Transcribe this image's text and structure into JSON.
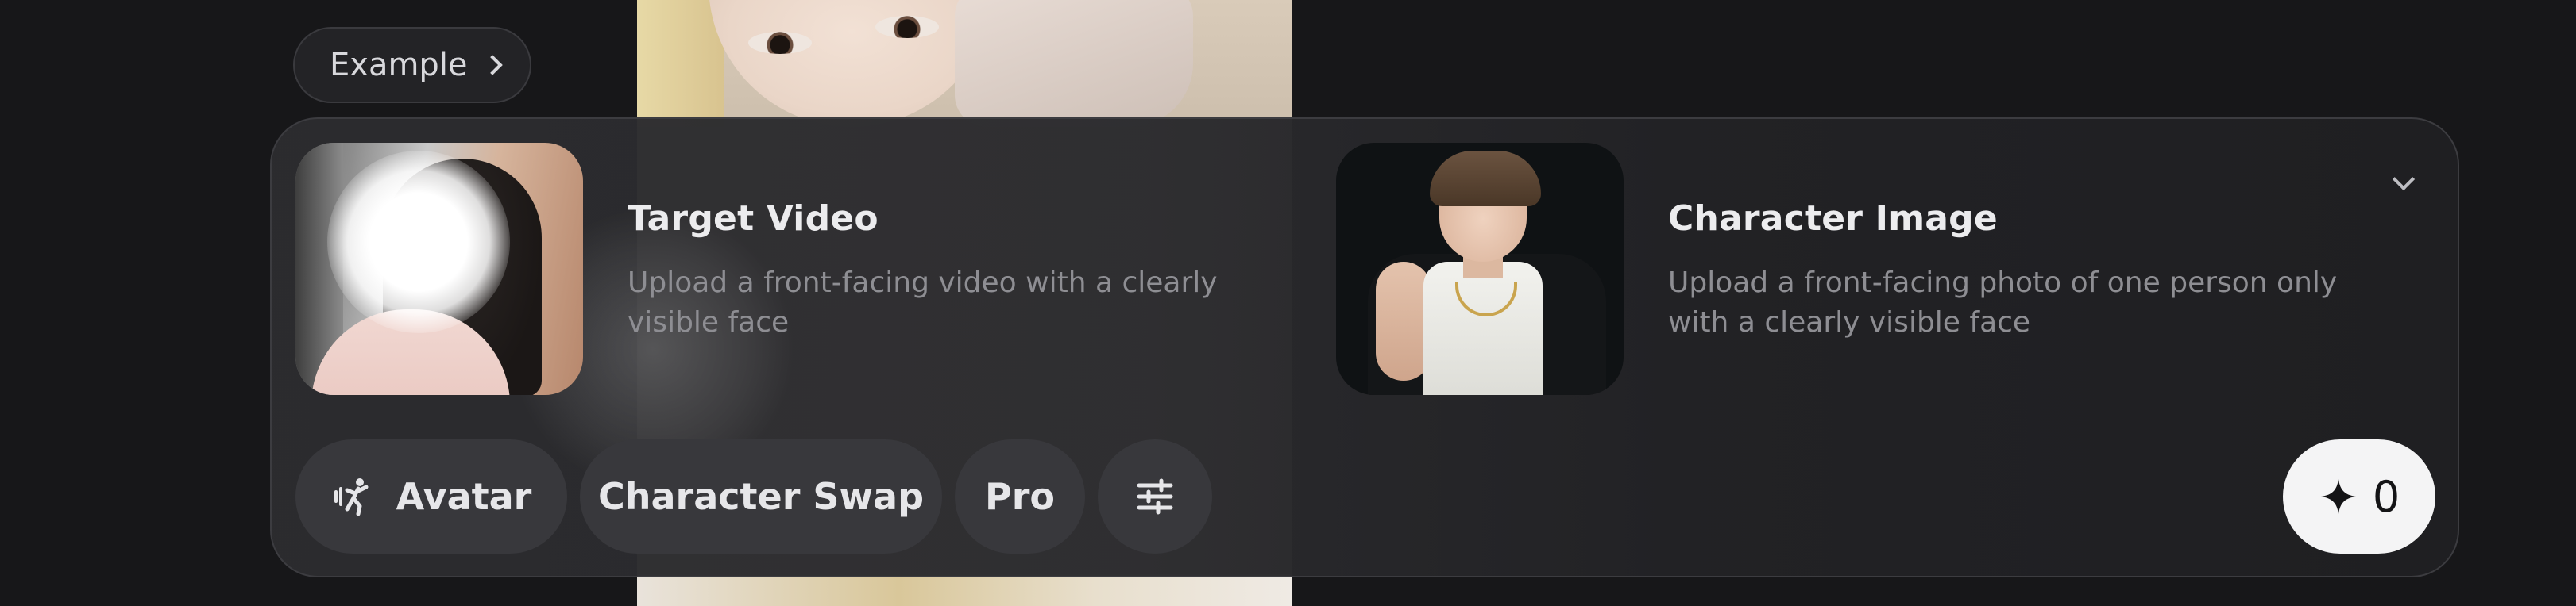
{
  "example_chip": {
    "label": "Example",
    "chevron_icon": "chevron-right-icon"
  },
  "card": {
    "target_video": {
      "title": "Target Video",
      "description": "Upload a front-facing video with a clearly visible face"
    },
    "character_image": {
      "title": "Character Image",
      "description": "Upload a front-facing photo of one person only with a clearly visible face"
    },
    "collapse_icon": "chevron-down-icon"
  },
  "toolbar": {
    "avatar": {
      "label": "Avatar",
      "icon": "avatar-dance-icon"
    },
    "character_swap": {
      "label": "Character Swap"
    },
    "pro": {
      "label": "Pro"
    },
    "settings": {
      "icon": "sliders-icon"
    }
  },
  "credits": {
    "icon": "sparkle-icon",
    "value": "0"
  },
  "colors": {
    "background": "#171719",
    "card": "#2c2c2f",
    "pill": "#38383c",
    "credits_button": "#f4f4f5",
    "title_text": "#ececee",
    "description_text": "#8e8e93"
  }
}
